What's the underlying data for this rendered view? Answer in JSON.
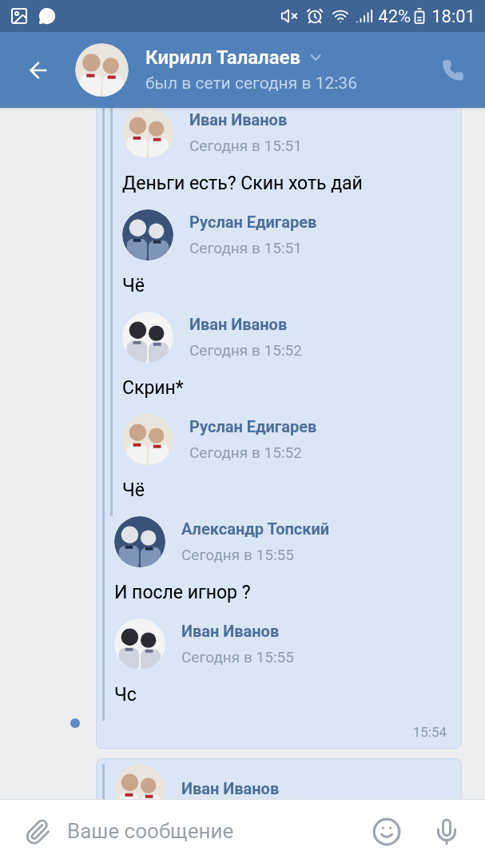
{
  "status_bar": {
    "battery": "42%",
    "time": "18:01"
  },
  "header": {
    "name": "Кирилл Талалаев",
    "status": "был в сети сегодня в 12:36"
  },
  "messages": [
    {
      "unread": true,
      "time": "15:54",
      "forwarded": [
        {
          "kind": "group",
          "items": [
            {
              "kind": "message",
              "author": "Иван Иванов",
              "time": "Сегодня в 15:51",
              "text": "Деньги есть? Скин хоть дай"
            },
            {
              "kind": "message",
              "author": "Руслан Едигарев",
              "time": "Сегодня в 15:51",
              "text": "Чё"
            },
            {
              "kind": "message",
              "author": "Иван Иванов",
              "time": "Сегодня в 15:52",
              "text": "Скрин*"
            },
            {
              "kind": "message",
              "author": "Руслан Едигарев",
              "time": "Сегодня в 15:52",
              "text": "Чё"
            }
          ]
        },
        {
          "kind": "message",
          "author": "Александр Топский",
          "time": "Сегодня в 15:55",
          "text": "И после игнор ?"
        },
        {
          "kind": "message",
          "author": "Иван Иванов",
          "time": "Сегодня в 15:55",
          "text": "Чс"
        }
      ]
    },
    {
      "unread": false,
      "forwarded": [
        {
          "kind": "message",
          "author": "Иван Иванов"
        }
      ]
    }
  ],
  "composer": {
    "placeholder": "Ваше сообщение"
  }
}
